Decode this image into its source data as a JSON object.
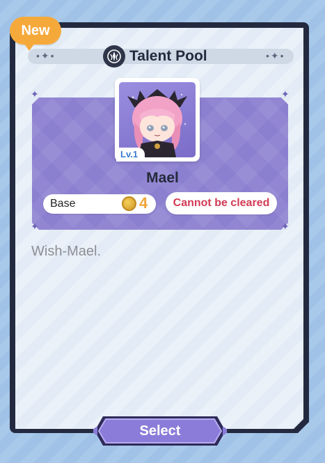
{
  "badge": {
    "label": "New"
  },
  "header": {
    "title": "Talent Pool",
    "icon": "talent-pool-icon",
    "deco": "•✦•"
  },
  "character": {
    "name": "Mael",
    "level": "Lv.1"
  },
  "stats": {
    "base_label": "Base",
    "base_icon": "coin-icon",
    "base_value": "4",
    "clear_status": "Cannot be cleared"
  },
  "description": "Wish-Mael.",
  "actions": {
    "select_label": "Select"
  },
  "colors": {
    "accent_purple": "#8b7fd0",
    "badge_orange": "#f6a93b",
    "warning_red": "#d23b55",
    "value_orange": "#f2a43a"
  }
}
